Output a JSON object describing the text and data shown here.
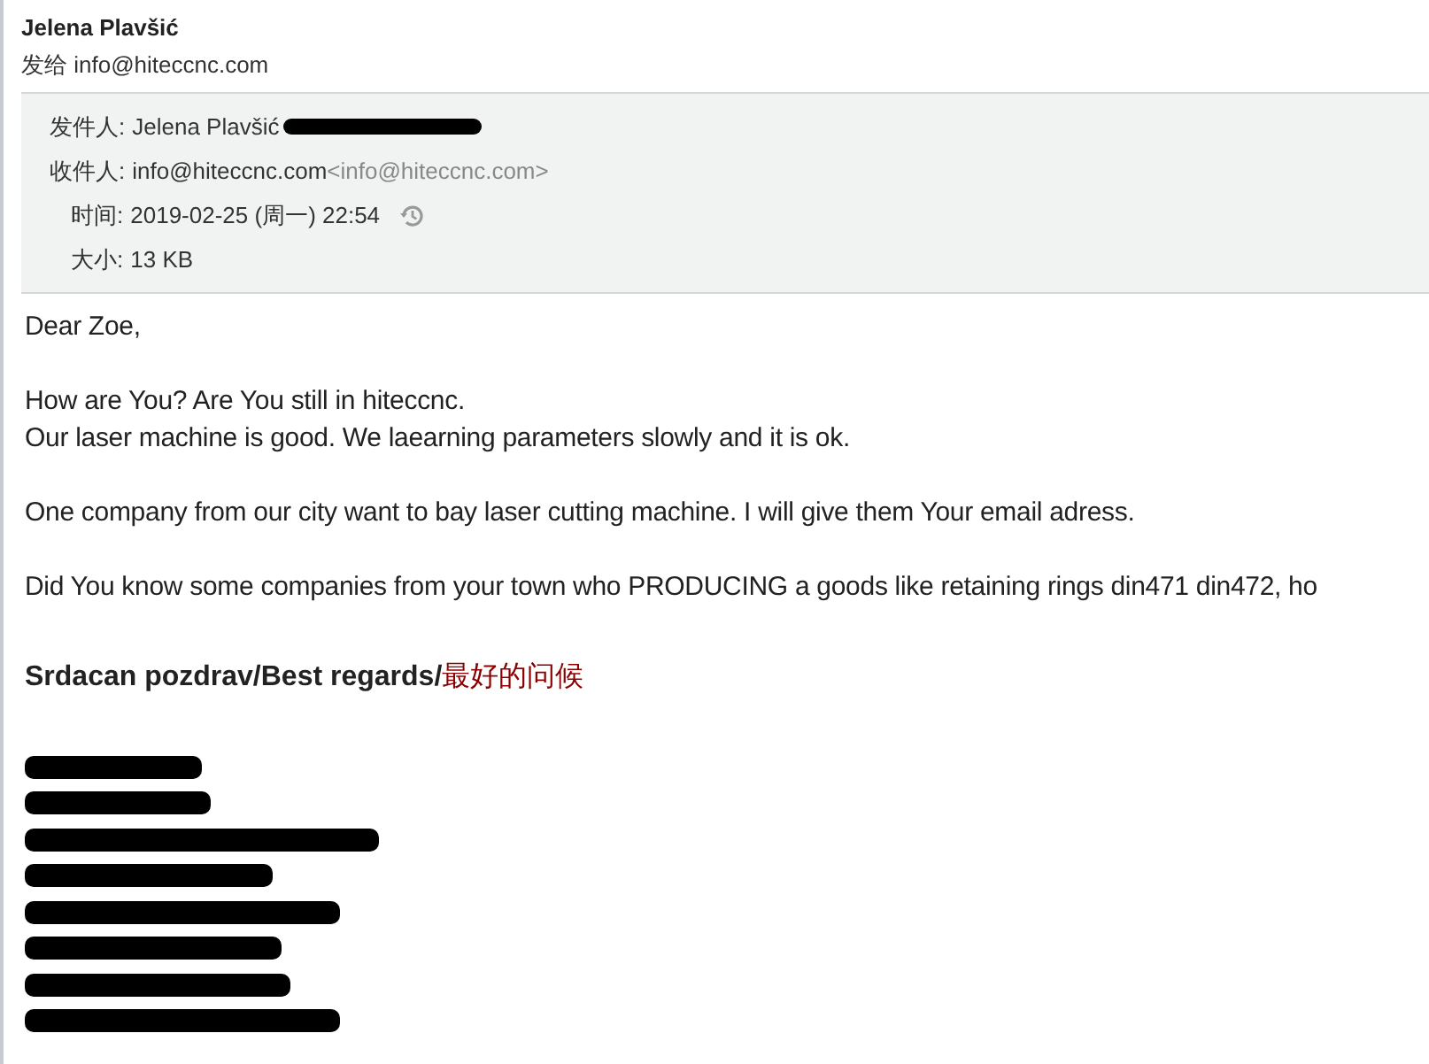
{
  "sender_name": "Jelena Plavšić",
  "sent_to": {
    "label": "发给",
    "address": "info@hiteccnc.com"
  },
  "details": [
    {
      "kind": "from",
      "label": "发件人:",
      "value": "Jelena Plavšić",
      "redacted": true
    },
    {
      "kind": "to",
      "label": "收件人:",
      "value": "info@hiteccnc.com",
      "extra": "<info@hiteccnc.com>"
    },
    {
      "kind": "time",
      "label": "时间:",
      "value": "2019-02-25 (周一) 22:54"
    },
    {
      "kind": "size",
      "label": "大小:",
      "value": "13 KB"
    }
  ],
  "body": [
    {
      "kind": "text",
      "text": "Dear Zoe,"
    },
    {
      "kind": "gap"
    },
    {
      "kind": "text",
      "text": "How are You? Are You still in hiteccnc."
    },
    {
      "kind": "text",
      "text": "Our laser machine is good. We laearning parameters slowly and it is ok."
    },
    {
      "kind": "gap"
    },
    {
      "kind": "text",
      "text": "One company from our city want to bay laser cutting machine. I will give them Your email adress."
    },
    {
      "kind": "gap"
    },
    {
      "kind": "text",
      "text": "Did You know some companies from your town who PRODUCING a goods like retaining rings din471 din472, ho"
    }
  ],
  "closing": {
    "latin": "Srdacan pozdrav/Best regards/",
    "chinese": "最好的问候"
  },
  "signature": [
    {
      "redacted": true
    },
    {
      "redacted": true
    },
    {
      "redacted": true
    },
    {
      "redacted": true
    },
    {
      "redacted": true
    },
    {
      "redacted": true
    },
    {
      "redacted": true
    },
    {
      "redacted": true
    }
  ]
}
